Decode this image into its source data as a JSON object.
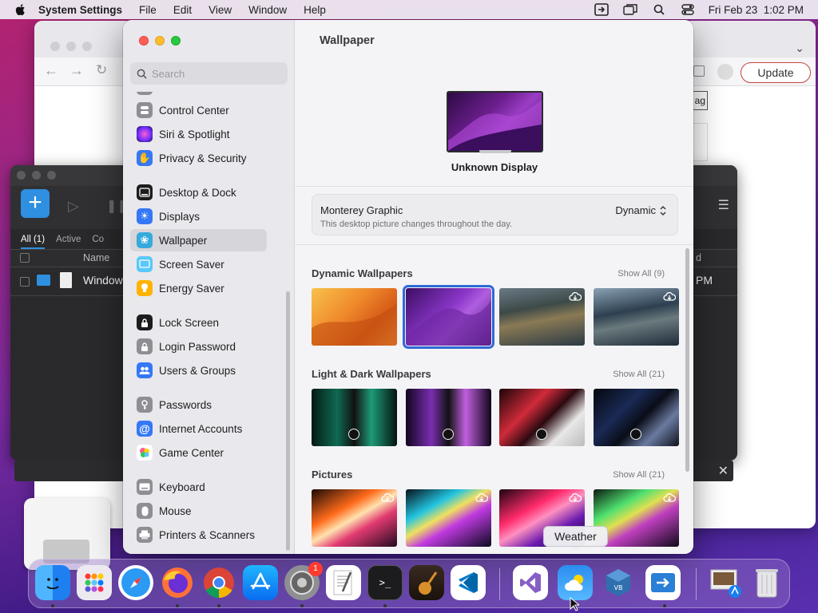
{
  "menubar": {
    "app_name": "System Settings",
    "items": [
      "File",
      "Edit",
      "View",
      "Window",
      "Help"
    ],
    "datetime": "Fri Feb 23  1:02 PM"
  },
  "browser": {
    "update_label": "Update",
    "tag_text": "ag"
  },
  "dark_window": {
    "tabs": [
      "All (1)",
      "Active",
      "Co"
    ],
    "col_name": "Name",
    "col_d": "d",
    "row_text": "Window",
    "row_time": "PM"
  },
  "sidebar": {
    "search_placeholder": "Search",
    "items": [
      {
        "label": "Control Center",
        "icon": "control-center-icon",
        "color": "#8e8e93"
      },
      {
        "label": "Siri & Spotlight",
        "icon": "siri-icon",
        "color": "#c2185b"
      },
      {
        "label": "Privacy & Security",
        "icon": "hand-icon",
        "color": "#3478f6"
      },
      {
        "label": "Desktop & Dock",
        "icon": "dock-icon",
        "color": "#1c1c1e"
      },
      {
        "label": "Displays",
        "icon": "sun-icon",
        "color": "#3478f6"
      },
      {
        "label": "Wallpaper",
        "icon": "wallpaper-icon",
        "color": "#35aadc"
      },
      {
        "label": "Screen Saver",
        "icon": "screen-saver-icon",
        "color": "#5ac8fa"
      },
      {
        "label": "Energy Saver",
        "icon": "bulb-icon",
        "color": "#ffb300"
      },
      {
        "label": "Lock Screen",
        "icon": "lock-icon",
        "color": "#1c1c1e"
      },
      {
        "label": "Login Password",
        "icon": "lock-icon",
        "color": "#8e8e93"
      },
      {
        "label": "Users & Groups",
        "icon": "users-icon",
        "color": "#3478f6"
      },
      {
        "label": "Passwords",
        "icon": "key-icon",
        "color": "#8e8e93"
      },
      {
        "label": "Internet Accounts",
        "icon": "at-icon",
        "color": "#3478f6"
      },
      {
        "label": "Game Center",
        "icon": "game-center-icon",
        "color": "#ffffff"
      },
      {
        "label": "Keyboard",
        "icon": "keyboard-icon",
        "color": "#8e8e93"
      },
      {
        "label": "Mouse",
        "icon": "mouse-icon",
        "color": "#8e8e93"
      },
      {
        "label": "Printers & Scanners",
        "icon": "printer-icon",
        "color": "#8e8e93"
      }
    ],
    "selected": "Wallpaper"
  },
  "content": {
    "title": "Wallpaper",
    "display_name": "Unknown Display",
    "current_wallpaper": "Monterey Graphic",
    "current_desc": "This desktop picture changes throughout the day.",
    "mode_value": "Dynamic",
    "sections": [
      {
        "title": "Dynamic Wallpapers",
        "show_all": "Show All (9)"
      },
      {
        "title": "Light & Dark Wallpapers",
        "show_all": "Show All (21)"
      },
      {
        "title": "Pictures",
        "show_all": "Show All (21)"
      }
    ]
  },
  "dock": {
    "apps": [
      "Finder",
      "Launchpad",
      "Safari",
      "Firefox",
      "Chrome",
      "App Store",
      "System Settings",
      "TextEdit",
      "Terminal",
      "GarageBand",
      "VS Code",
      "Visual Studio",
      "Weather",
      "VirtualBox",
      "Migration Assistant",
      "Preview",
      "Trash"
    ],
    "settings_badge": "1",
    "tooltip": "Weather"
  },
  "colors": {
    "accent": "#2d6ad6",
    "update_border": "#c5453a"
  }
}
